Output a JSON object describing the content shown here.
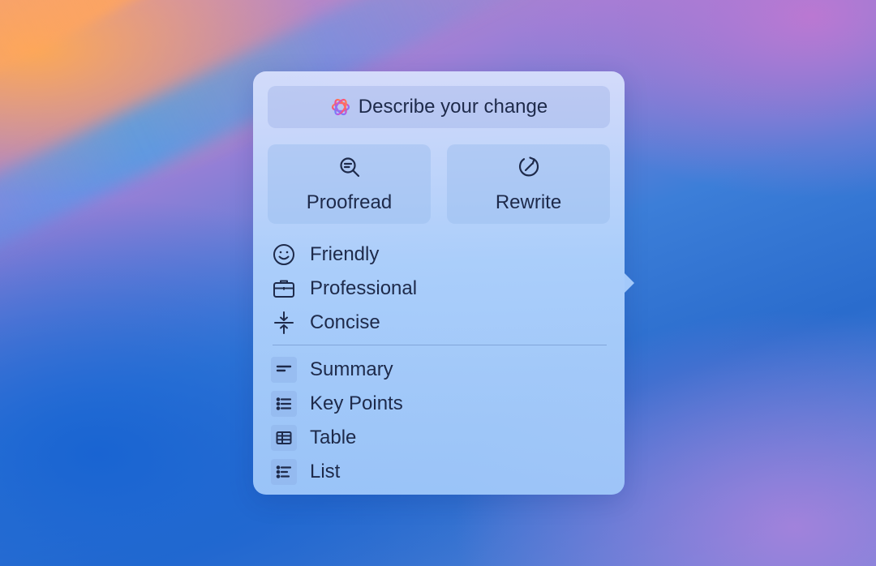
{
  "popover": {
    "describe_label": "Describe your change",
    "actions": {
      "proofread": "Proofread",
      "rewrite": "Rewrite"
    },
    "tones": [
      {
        "label": "Friendly",
        "icon": "smiley-icon"
      },
      {
        "label": "Professional",
        "icon": "briefcase-icon"
      },
      {
        "label": "Concise",
        "icon": "compress-arrows-icon"
      }
    ],
    "formats": [
      {
        "label": "Summary",
        "icon": "summary-lines-icon"
      },
      {
        "label": "Key Points",
        "icon": "bullet-list-icon"
      },
      {
        "label": "Table",
        "icon": "table-icon"
      },
      {
        "label": "List",
        "icon": "list-icon"
      }
    ]
  },
  "colors": {
    "text": "#1e2a4a",
    "panel_top": "#d6defc",
    "panel_bottom": "#a0c8fa"
  }
}
